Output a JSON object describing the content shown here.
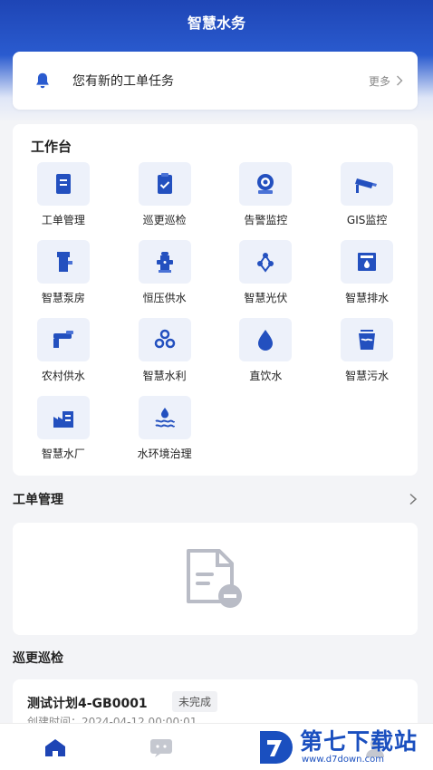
{
  "app": {
    "title": "智慧水务"
  },
  "notice": {
    "text": "您有新的工单任务",
    "more": "更多"
  },
  "workbench": {
    "title": "工作台",
    "items": [
      {
        "label": "工单管理",
        "icon": "work-order-icon"
      },
      {
        "label": "巡更巡检",
        "icon": "clipboard-check-icon"
      },
      {
        "label": "告警监控",
        "icon": "alarm-camera-icon"
      },
      {
        "label": "GIS监控",
        "icon": "cctv-camera-icon"
      },
      {
        "label": "智慧泵房",
        "icon": "pump-room-icon"
      },
      {
        "label": "恒压供水",
        "icon": "fire-hydrant-icon"
      },
      {
        "label": "智慧光伏",
        "icon": "solar-icon"
      },
      {
        "label": "智慧排水",
        "icon": "drainage-icon"
      },
      {
        "label": "农村供水",
        "icon": "faucet-icon"
      },
      {
        "label": "智慧水利",
        "icon": "hexagons-icon"
      },
      {
        "label": "直饮水",
        "icon": "water-drop-icon"
      },
      {
        "label": "智慧污水",
        "icon": "sewage-bucket-icon"
      },
      {
        "label": "智慧水厂",
        "icon": "factory-icon"
      },
      {
        "label": "水环境治理",
        "icon": "water-waves-icon"
      }
    ]
  },
  "work_orders": {
    "title": "工单管理"
  },
  "patrol": {
    "title": "巡更巡检",
    "item": {
      "name": "测试计划4-GB0001",
      "status": "未完成",
      "created": "创建时间：2024-04-12 00:00:01"
    }
  },
  "tabbar": {
    "tabs": [
      {
        "icon": "home-icon"
      },
      {
        "icon": "message-icon"
      },
      {
        "icon": "profile-icon"
      }
    ]
  },
  "watermark": {
    "text": "第七下载站",
    "url": "www.d7down.com"
  },
  "colors": {
    "primary": "#1e45b5",
    "icon_blue": "#2350bf",
    "icon_bg": "#edf1fa"
  }
}
